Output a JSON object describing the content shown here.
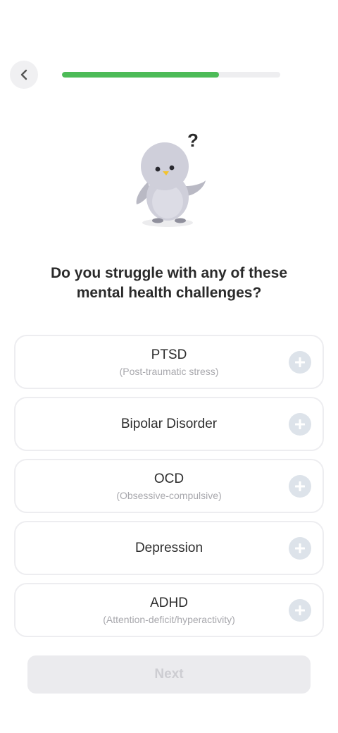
{
  "header": {
    "back_icon": "chevron-left-icon",
    "progress": 0.72
  },
  "mascot": {
    "icon": "penguin-mascot",
    "bubble": "?"
  },
  "question": {
    "line1": "Do you struggle with any of these",
    "line2": "mental health challenges?"
  },
  "options": [
    {
      "title": "PTSD",
      "subtitle": "(Post-traumatic stress)",
      "icon": "plus-icon"
    },
    {
      "title": "Bipolar Disorder",
      "subtitle": "",
      "icon": "plus-icon"
    },
    {
      "title": "OCD",
      "subtitle": "(Obsessive-compulsive)",
      "icon": "plus-icon"
    },
    {
      "title": "Depression",
      "subtitle": "",
      "icon": "plus-icon"
    },
    {
      "title": "ADHD",
      "subtitle": "(Attention-deficit/hyperactivity)",
      "icon": "plus-icon"
    }
  ],
  "footer": {
    "next_label": "Next"
  },
  "colors": {
    "progress": "#4cbb57",
    "track": "#eeeef0",
    "plus_bg": "#dde3ea",
    "disabled_button": "#ebebee"
  }
}
